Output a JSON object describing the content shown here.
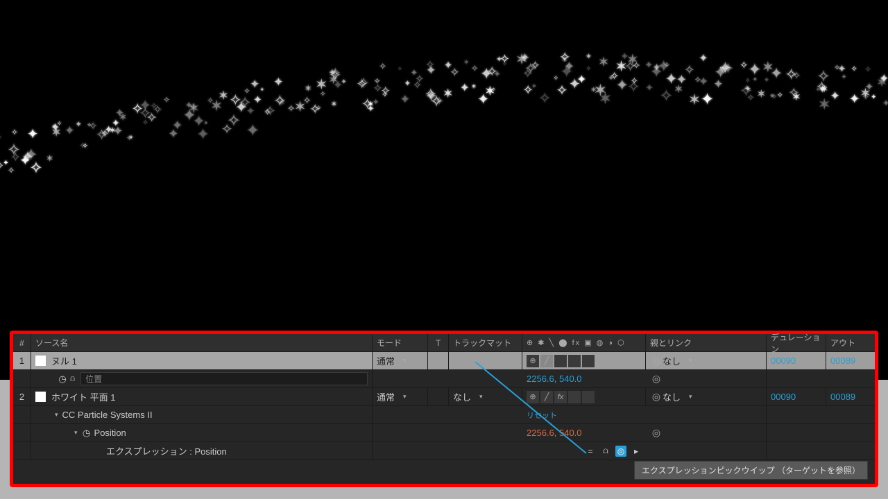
{
  "columns": {
    "num": "#",
    "source": "ソース名",
    "mode": "モード",
    "t": "T",
    "track": "トラックマット",
    "switches_glyphs": "⊕ ✱ ╲ ⬤ fx ▣ ◍ ◑ ⬡",
    "parent": "親とリンク",
    "duration": "デュレーション",
    "out": "アウト"
  },
  "layers": [
    {
      "num": "1",
      "name": "ヌル 1",
      "mode": "通常",
      "track": "",
      "parent": "なし",
      "duration": "00090",
      "out": "00089",
      "prop": {
        "label": "位置",
        "value": "2256.6, 540.0"
      }
    },
    {
      "num": "2",
      "name": "ホワイト 平面 1",
      "mode": "通常",
      "track": "なし",
      "parent": "なし",
      "duration": "00090",
      "out": "00089",
      "effect": {
        "name": "CC Particle Systems II",
        "reset": "リセット",
        "prop": {
          "label": "Position",
          "value": "2256.6, 540.0",
          "expr_label": "エクスプレッション : Position"
        }
      }
    }
  ],
  "tooltip": "エクスプレッションピックウイップ （ターゲットを参照）"
}
